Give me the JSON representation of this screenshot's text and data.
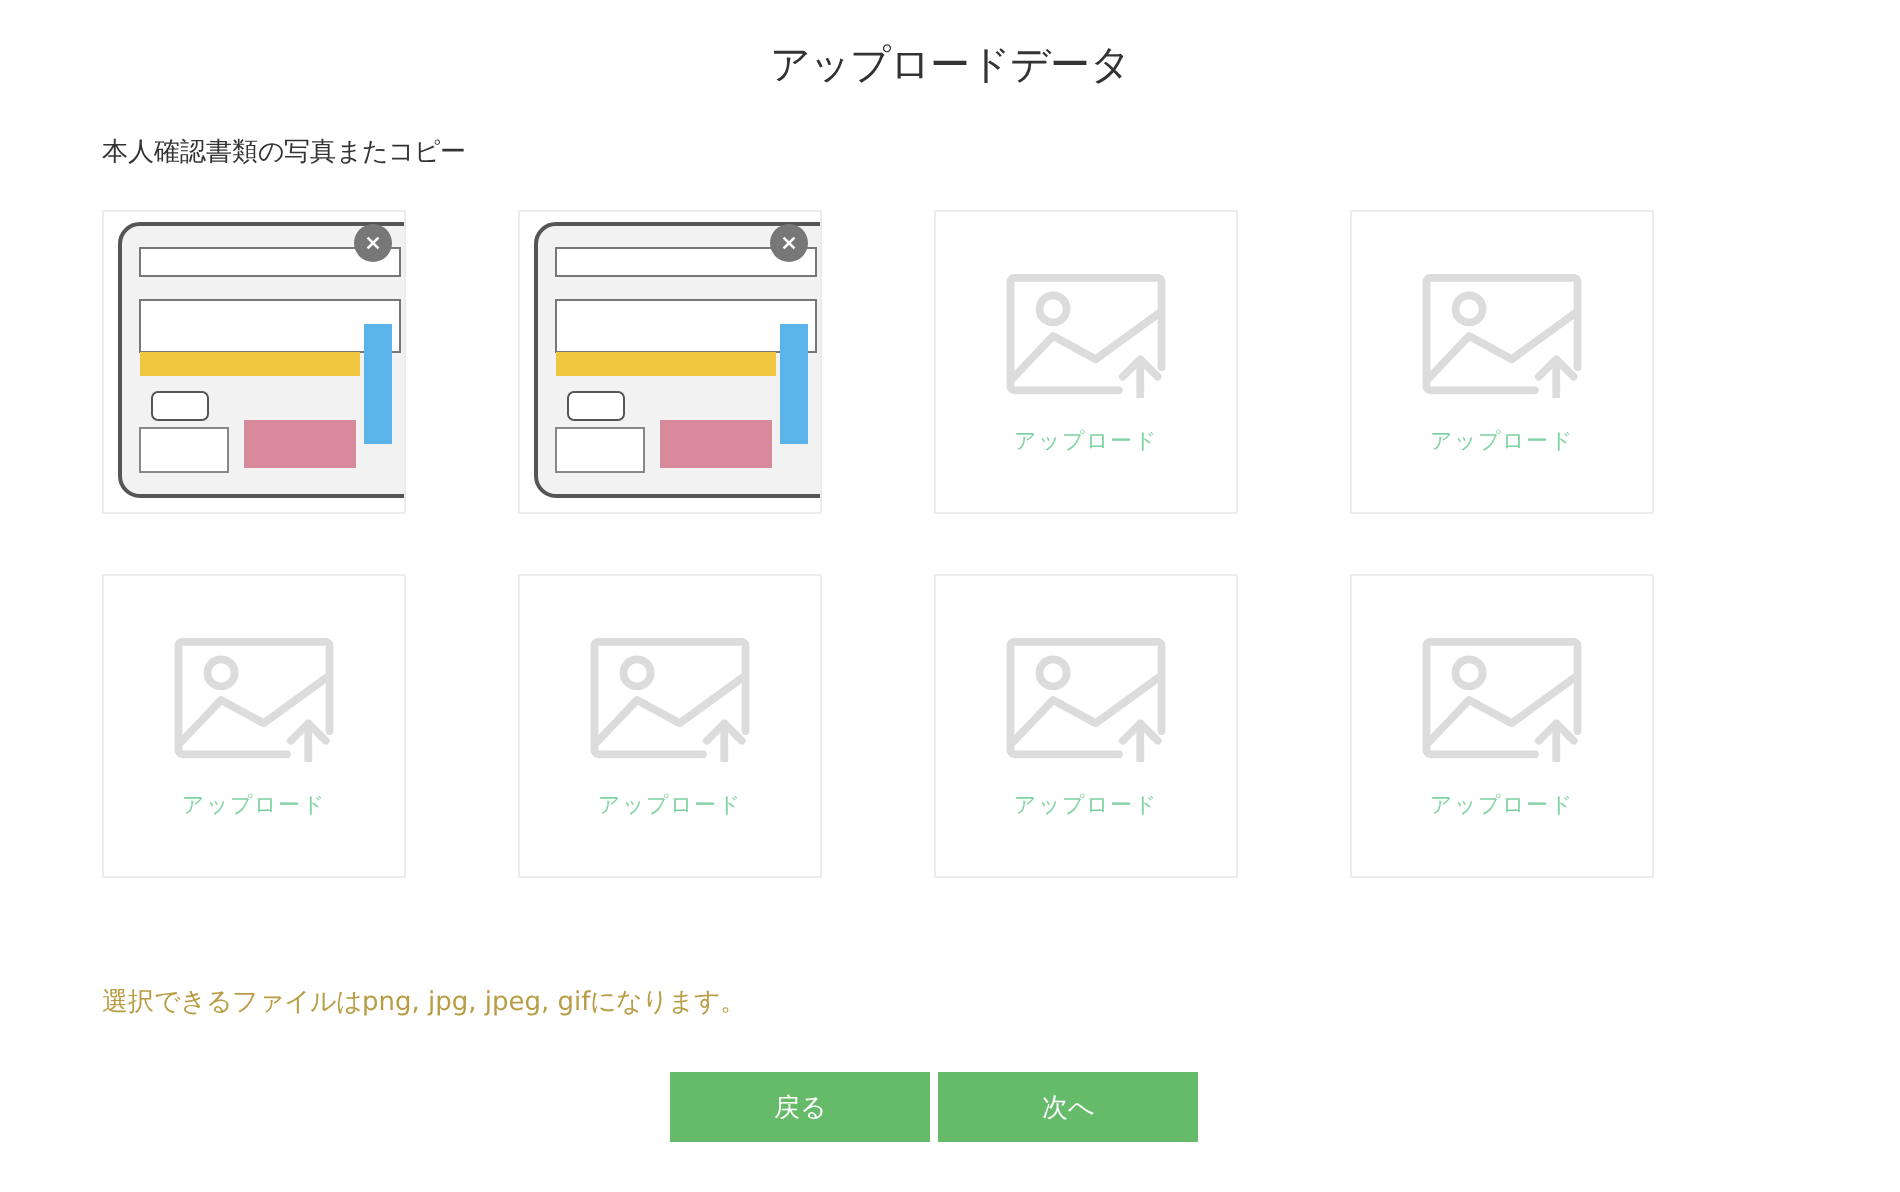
{
  "title": "アップロードデータ",
  "section_label": "本人確認書類の写真またコピー",
  "slots": [
    {
      "kind": "uploaded"
    },
    {
      "kind": "uploaded"
    },
    {
      "kind": "empty",
      "label": "アップロード"
    },
    {
      "kind": "empty",
      "label": "アップロード"
    },
    {
      "kind": "empty",
      "label": "アップロード"
    },
    {
      "kind": "empty",
      "label": "アップロード"
    },
    {
      "kind": "empty",
      "label": "アップロード"
    },
    {
      "kind": "empty",
      "label": "アップロード"
    }
  ],
  "note": "選択できるファイルはpng, jpg, jpeg, gifになります。",
  "buttons": [
    "戻る",
    "次へ"
  ]
}
